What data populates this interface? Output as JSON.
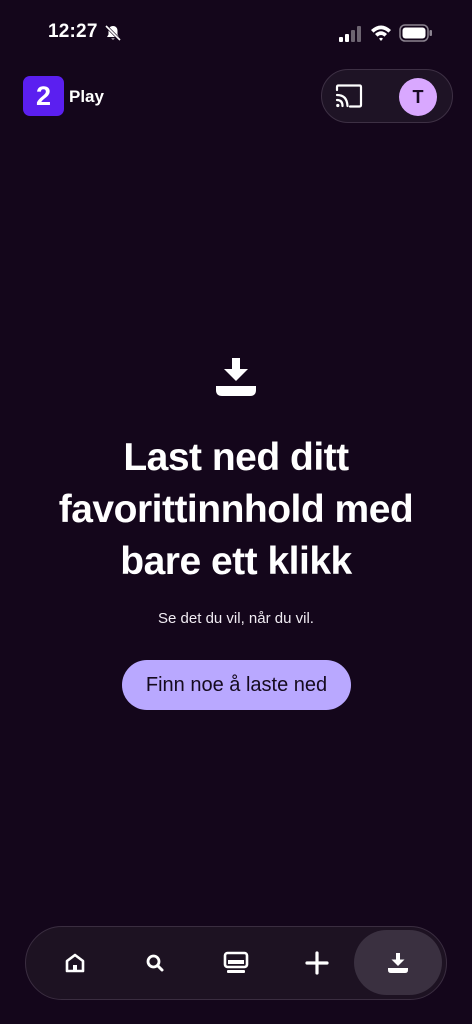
{
  "status_bar": {
    "time": "12:27",
    "icons": [
      "bell-off-icon",
      "signal-icon",
      "wifi-icon",
      "battery-icon"
    ]
  },
  "header": {
    "logo_number": "2",
    "logo_text": "Play",
    "cast_icon": "cast-icon",
    "avatar_initial": "T"
  },
  "main": {
    "icon": "download-icon",
    "headline_lines": [
      "Last ned ditt",
      "favorittinnhold med",
      "bare ett klikk"
    ],
    "subtitle": "Se det du vil, når du vil.",
    "cta_label": "Finn noe å laste ned"
  },
  "bottom_nav": {
    "items": [
      {
        "icon": "home-icon",
        "active": false
      },
      {
        "icon": "search-icon",
        "active": false
      },
      {
        "icon": "tv-icon",
        "active": false
      },
      {
        "icon": "plus-icon",
        "active": false
      },
      {
        "icon": "download-icon",
        "active": true
      }
    ]
  },
  "colors": {
    "background": "#14061b",
    "brand": "#5b1ff0",
    "cta": "#b9a8ff",
    "avatar": "#d9a8ff"
  }
}
